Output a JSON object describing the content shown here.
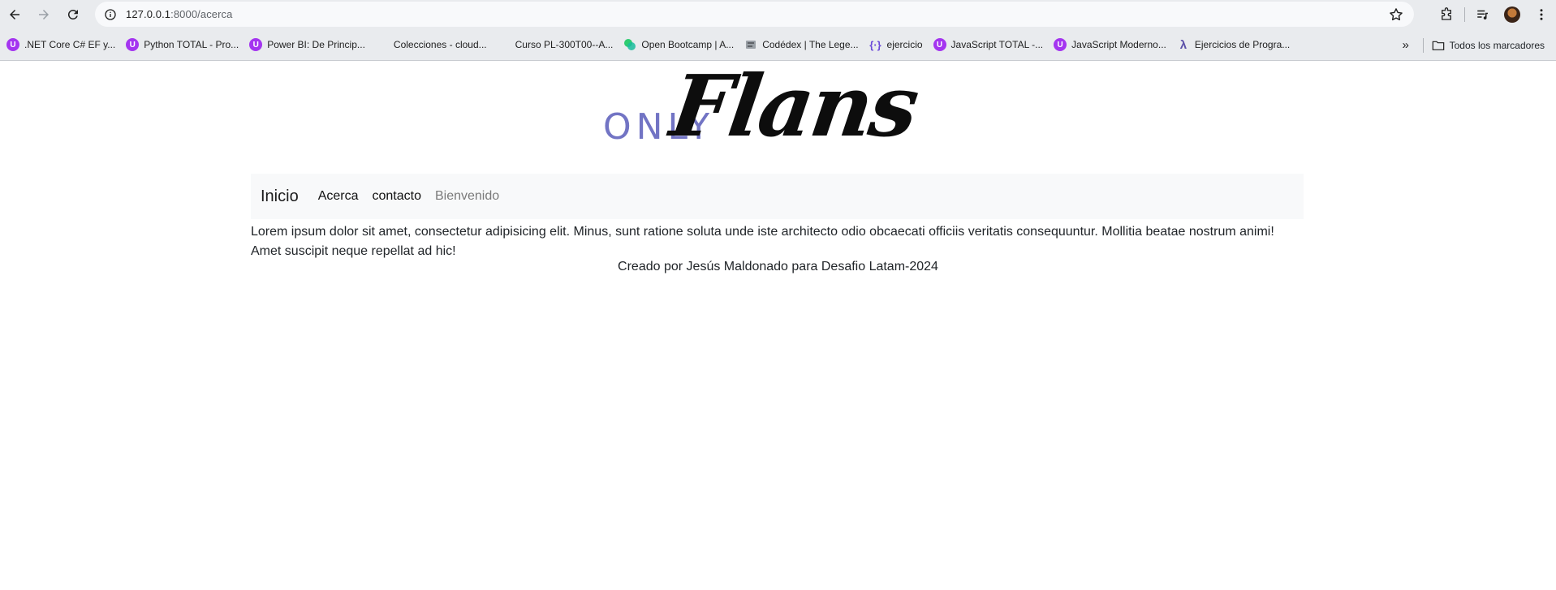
{
  "browser": {
    "url_host": "127.0.0.1",
    "url_rest": ":8000/acerca",
    "bookmarks": [
      {
        "label": ".NET Core C# EF y...",
        "icon": "udemy-icon"
      },
      {
        "label": "Python TOTAL - Pro...",
        "icon": "udemy-icon"
      },
      {
        "label": "Power BI: De Princip...",
        "icon": "udemy-icon"
      },
      {
        "label": "Colecciones - cloud...",
        "icon": "microsoft-icon"
      },
      {
        "label": "Curso PL-300T00--A...",
        "icon": "microsoft-icon"
      },
      {
        "label": "Open Bootcamp | A...",
        "icon": "openbootcamp-icon"
      },
      {
        "label": "Codédex | The Lege...",
        "icon": "codedex-icon"
      },
      {
        "label": "ejercicio",
        "icon": "code-braces-icon"
      },
      {
        "label": "JavaScript TOTAL -...",
        "icon": "udemy-icon"
      },
      {
        "label": "JavaScript Moderno...",
        "icon": "udemy-icon"
      },
      {
        "label": "Ejercicios de Progra...",
        "icon": "lambda-icon"
      }
    ],
    "all_bookmarks_label": "Todos los marcadores",
    "overflow_chevron": "»"
  },
  "logo": {
    "prefix": "ONLY",
    "script": "Flans",
    "prefix_color": "#7274c4"
  },
  "navbar": {
    "brand": "Inicio",
    "links": [
      "Acerca",
      "contacto",
      "Bienvenido"
    ]
  },
  "content": {
    "paragraph": "Lorem ipsum dolor sit amet, consectetur adipisicing elit. Minus, sunt ratione soluta unde iste architecto odio obcaecati officiis veritatis consequuntur. Mollitia beatae nostrum animi! Amet suscipit neque repellat ad hic!"
  },
  "footer": {
    "text": "Creado por Jesús Maldonado para Desafio Latam-2024"
  }
}
